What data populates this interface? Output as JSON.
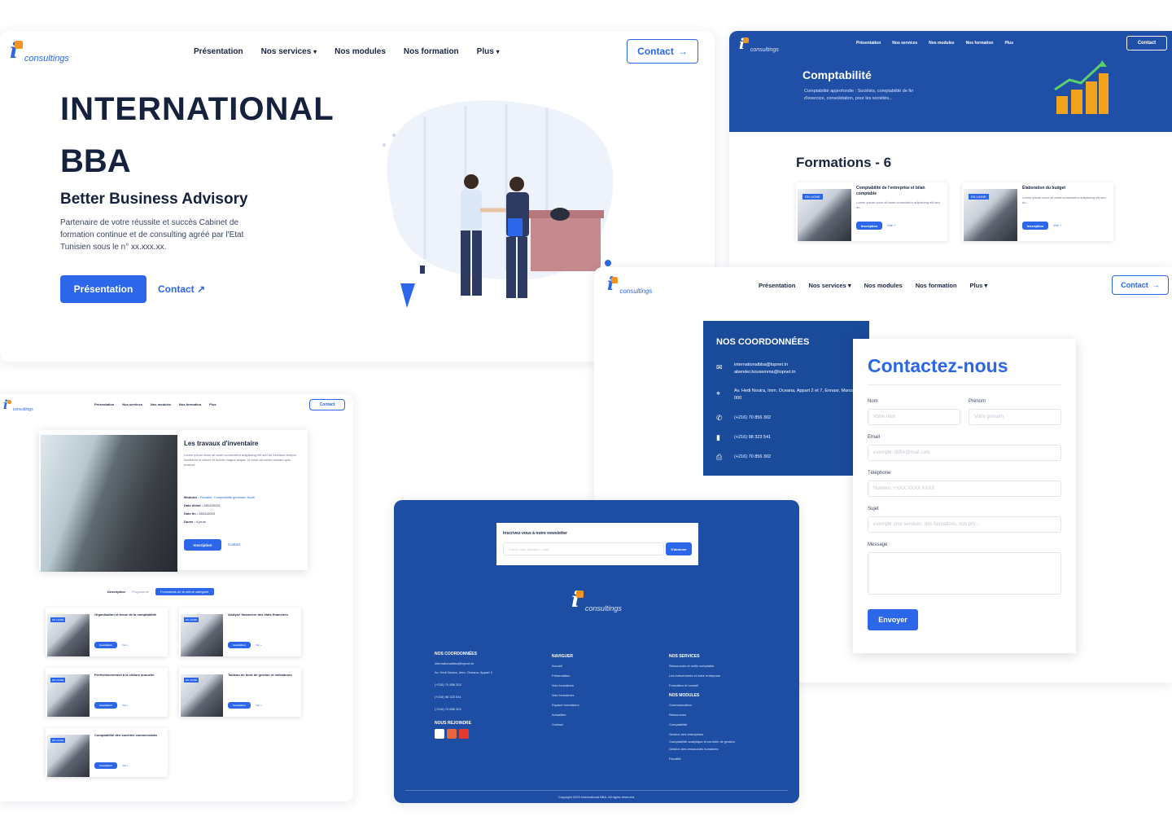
{
  "brand": {
    "logo_text": "iBBA",
    "logo_tagline": "consultings"
  },
  "nav": {
    "items": [
      "Présentation",
      "Nos services",
      "Nos modules",
      "Nos formation",
      "Plus"
    ],
    "contact_label": "Contact"
  },
  "hero": {
    "title_line1": "INTERNATIONAL",
    "title_line2": "BBA",
    "subtitle": "Better Business Advisory",
    "description": "Partenaire de votre réussite et succès Cabinet de formation continue et de consulting agréé par l'Etat Tunisien sous le n° xx.xxx.xx.",
    "primary_label": "Présentation",
    "secondary_label": "Contact"
  },
  "comptabilite": {
    "title": "Comptabilité",
    "description": "Comptabilité approfondie : Sociétés, comptabilité de fin d'exercice, consolidation, pour les sociétés...",
    "formations_heading": "Formations - 6",
    "cards": [
      {
        "badge": "EN LIGNE",
        "title": "Comptabilité de l'entreprise et bilan comptable",
        "text": "Lorem ipsum dolor sit amet consectetur adipiscing elit sed do...",
        "btn": "Inscription",
        "more": "Voir +"
      },
      {
        "badge": "EN LIGNE",
        "title": "Élaboration du budget",
        "text": "Lorem ipsum dolor sit amet consectetur adipiscing elit sed do...",
        "btn": "Inscription",
        "more": "Voir +"
      }
    ]
  },
  "formation_detail": {
    "title": "Les travaux d'inventaire",
    "text": "Lorem ipsum dolor sit amet consectetur adipiscing elit sed do eiusmod tempor incididunt ut labore et dolore magna aliqua. Ut enim ad minim veniam quis nostrud.",
    "meta": [
      {
        "k": "Modules :",
        "v": "Fiscalité, Comptabilité générale, Audit"
      },
      {
        "k": "Date début :",
        "v": "28/11/2023"
      },
      {
        "k": "Date fin :",
        "v": "28/11/2023"
      },
      {
        "k": "Durée :",
        "v": "4 jours"
      }
    ],
    "btn": "Inscription",
    "link": "Contact",
    "tabs": [
      "Description",
      "Programme",
      "Formations de la même catégorie"
    ],
    "related": [
      {
        "badge": "EN LIGNE",
        "title": "Organisation et tenue de la comptabilité",
        "btn": "Inscription",
        "more": "Voir +"
      },
      {
        "badge": "EN LIGNE",
        "title": "Analyse financière des états financiers",
        "btn": "Inscription",
        "more": "Voir +"
      },
      {
        "badge": "EN LIGNE",
        "title": "Perfectionnement à la clôture annuelle",
        "btn": "Inscription",
        "more": "Voir +"
      },
      {
        "badge": "EN LIGNE",
        "title": "Tableau de bord de gestion et indicateurs",
        "btn": "Inscription",
        "more": "Voir +"
      },
      {
        "badge": "EN LIGNE",
        "title": "Comptabilité des sociétés commerciales",
        "btn": "Inscription",
        "more": "Voir +"
      }
    ]
  },
  "contact": {
    "coords_title": "NOS COORDONNÉES",
    "emails": "internationalbba@topnet.tn\nabender.bousemma@topnet.tn",
    "address": "Av. Hedi Nouira, Imm. Oceana, Appart 2 et 7, Ennasr, Manzah 8 000",
    "phones": [
      "(+216) 70 856 302",
      "(+216) 98 323 541",
      "(+216) 70 856 302"
    ],
    "title": "Contactez-nous",
    "fields": {
      "nom_label": "Nom",
      "nom_ph": "Votre nom",
      "prenom_label": "Prénom",
      "prenom_ph": "Votre prénom",
      "email_label": "Email",
      "email_ph": "exemple: iBBA@mail.com",
      "tel_label": "Téléphone",
      "tel_ph": "Numéro: +XXX XXXX XXXX",
      "sujet_label": "Sujet",
      "sujet_ph": "exemple: nos services, nos formations, nos pro...",
      "message_label": "Message"
    },
    "submit": "Envoyer"
  },
  "footer": {
    "newsletter_title": "Inscrivez-vous à notre newsletter",
    "newsletter_ph": "Entrez votre adresse e-mail",
    "newsletter_btn": "S'abonner",
    "col1_title": "NOS COORDONNÉES",
    "col1_items": [
      "internationalbba@topnet.tn",
      "Av. Hedi Nouira, Imm. Oceana, Appart 2",
      "(+216) 70 856 302",
      "(+216) 98 323 541",
      "(+216) 70 856 302"
    ],
    "social_title": "NOUS REJOINDRE",
    "col2_title": "NAVIGUER",
    "col2_items": [
      "Accueil",
      "Présentation",
      "Nos formations",
      "Nos formateurs",
      "Espace formateurs",
      "Actualités",
      "Contact"
    ],
    "col3_title": "NOS SERVICES",
    "col3_items": [
      "Ressources et veille comptable",
      "Les évènements et notre entreprise",
      "Formation et conseil"
    ],
    "col3b_title": "NOS MODULES",
    "col3b_items": [
      "Communication",
      "Ressources",
      "Comptabilité",
      "Gestion des entreprises",
      "Comptabilité analytique et contrôle de gestion",
      "Gestion des ressources humaines",
      "Fiscalité"
    ],
    "copyright": "Copyright 2023 International BBA. All rights reserved."
  }
}
